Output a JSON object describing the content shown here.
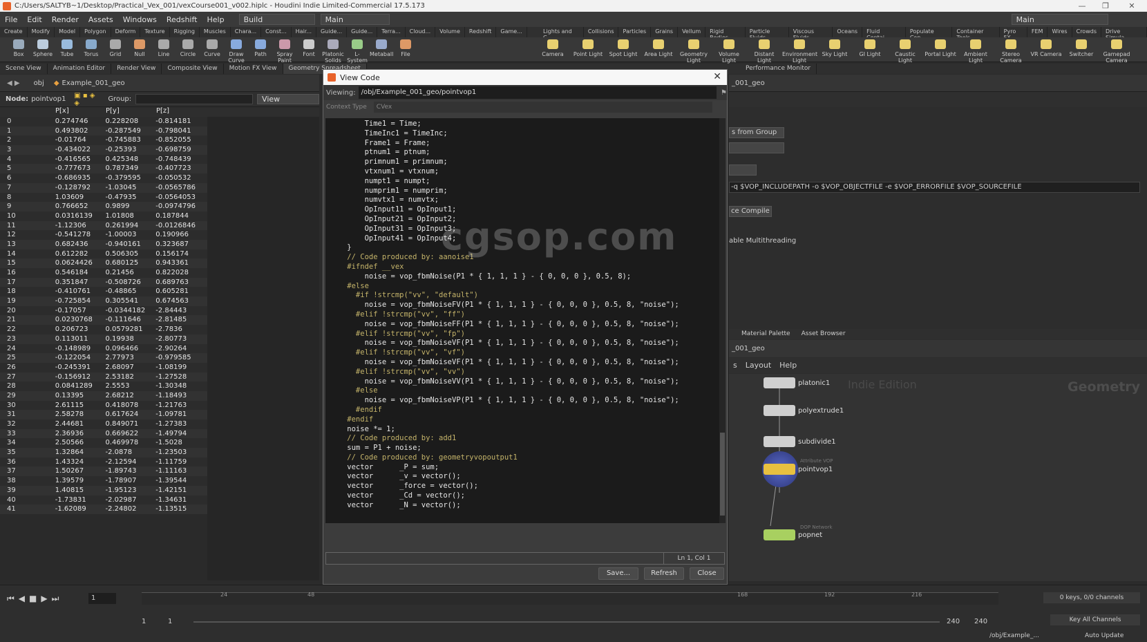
{
  "window": {
    "title": "C:/Users/SALTYB~1/Desktop/Practical_Vex_001/vexCourse001_v002.hiplc - Houdini Indie Limited-Commercial 17.5.173"
  },
  "menu": {
    "items": [
      "File",
      "Edit",
      "Render",
      "Assets",
      "Windows",
      "Redshift",
      "Help"
    ],
    "desktop": "Build",
    "main": "Main",
    "main_right": "Main"
  },
  "shelf_tabs_left": [
    "Create",
    "Modify",
    "Model",
    "Polygon",
    "Deform",
    "Texture",
    "Rigging",
    "Muscles",
    "Chara...",
    "Const...",
    "Hair...",
    "Guide...",
    "Guide...",
    "Terra...",
    "Cloud...",
    "Volume",
    "Redshift",
    "Game..."
  ],
  "shelf_tabs_right": [
    "Lights and C...",
    "Collisions",
    "Particles",
    "Grains",
    "Vellum",
    "Rigid Bodies",
    "Particle Fluids",
    "Viscous Fluids",
    "Oceans",
    "Fluid Contai...",
    "Populate Con...",
    "Container Tools",
    "Pyro FX",
    "FEM",
    "Wires",
    "Crowds",
    "Drive Simula..."
  ],
  "tools_left": [
    "Box",
    "Sphere",
    "Tube",
    "Torus",
    "Grid",
    "Null",
    "Line",
    "Circle",
    "Curve",
    "Draw Curve",
    "Path",
    "Spray Paint",
    "Font",
    "Platonic Solids",
    "L-System",
    "Metaball",
    "File"
  ],
  "tools_right": [
    "Camera",
    "Point Light",
    "Spot Light",
    "Area Light",
    "Geometry Light",
    "Volume Light",
    "Distant Light",
    "Environment Light",
    "Sky Light",
    "GI Light",
    "Caustic Light",
    "Portal Light",
    "Ambient Light",
    "Stereo Camera",
    "VR Camera",
    "Switcher",
    "Gamepad Camera"
  ],
  "pane_tabs": [
    "Scene View",
    "Animation Editor",
    "Render View",
    "Composite View",
    "Motion FX View",
    "Geometry Spreadsheet"
  ],
  "pane_tabs_right": [
    "Performance Monitor"
  ],
  "path": {
    "obj": "obj",
    "geo": "Example_001_geo"
  },
  "node_bar": {
    "label": "Node:",
    "node": "pointvop1",
    "group_label": "Group:",
    "view": "View"
  },
  "sheet": {
    "headers": [
      "",
      "P[x]",
      "P[y]",
      "P[z]"
    ],
    "rows": [
      [
        "0",
        "0.274746",
        "0.228208",
        "-0.814181"
      ],
      [
        "1",
        "0.493802",
        "-0.287549",
        "-0.798041"
      ],
      [
        "2",
        "-0.01764",
        "-0.745883",
        "-0.852055"
      ],
      [
        "3",
        "-0.434022",
        "-0.25393",
        "-0.698759"
      ],
      [
        "4",
        "-0.416565",
        "0.425348",
        "-0.748439"
      ],
      [
        "5",
        "-0.777673",
        "0.787349",
        "-0.407723"
      ],
      [
        "6",
        "-0.686935",
        "-0.379595",
        "-0.050532"
      ],
      [
        "7",
        "-0.128792",
        "-1.03045",
        "-0.0565786"
      ],
      [
        "8",
        "1.03609",
        "-0.47935",
        "-0.0564053"
      ],
      [
        "9",
        "0.766652",
        "0.9899",
        "-0.0974796"
      ],
      [
        "10",
        "0.0316139",
        "1.01808",
        "0.187844"
      ],
      [
        "11",
        "-1.12306",
        "0.261994",
        "-0.0126846"
      ],
      [
        "12",
        "-0.541278",
        "-1.00003",
        "0.190966"
      ],
      [
        "13",
        "0.682436",
        "-0.940161",
        "0.323687"
      ],
      [
        "14",
        "0.612282",
        "0.506305",
        "0.156174"
      ],
      [
        "15",
        "0.0624426",
        "0.680125",
        "0.943361"
      ],
      [
        "16",
        "0.546184",
        "0.21456",
        "0.822028"
      ],
      [
        "17",
        "0.351847",
        "-0.508726",
        "0.689763"
      ],
      [
        "18",
        "-0.410761",
        "-0.48865",
        "0.605281"
      ],
      [
        "19",
        "-0.725854",
        "0.305541",
        "0.674563"
      ],
      [
        "20",
        "-0.17057",
        "-0.0344182",
        "-2.84443"
      ],
      [
        "21",
        "0.0230768",
        "-0.111646",
        "-2.81485"
      ],
      [
        "22",
        "0.206723",
        "0.0579281",
        "-2.7836"
      ],
      [
        "23",
        "0.113011",
        "0.19938",
        "-2.80773"
      ],
      [
        "24",
        "-0.148989",
        "0.096466",
        "-2.90264"
      ],
      [
        "25",
        "-0.122054",
        "2.77973",
        "-0.979585"
      ],
      [
        "26",
        "-0.245391",
        "2.68097",
        "-1.08199"
      ],
      [
        "27",
        "-0.156912",
        "2.53182",
        "-1.27528"
      ],
      [
        "28",
        "0.0841289",
        "2.5553",
        "-1.30348"
      ],
      [
        "29",
        "0.13395",
        "2.68212",
        "-1.18493"
      ],
      [
        "30",
        "2.61115",
        "0.418078",
        "-1.21763"
      ],
      [
        "31",
        "2.58278",
        "0.617624",
        "-1.09781"
      ],
      [
        "32",
        "2.44681",
        "0.849071",
        "-1.27383"
      ],
      [
        "33",
        "2.36936",
        "0.669622",
        "-1.49794"
      ],
      [
        "34",
        "2.50566",
        "0.469978",
        "-1.5028"
      ],
      [
        "35",
        "1.32864",
        "-2.0878",
        "-1.23503"
      ],
      [
        "36",
        "1.43324",
        "-2.12594",
        "-1.11759"
      ],
      [
        "37",
        "1.50267",
        "-1.89743",
        "-1.11163"
      ],
      [
        "38",
        "1.39579",
        "-1.78907",
        "-1.39544"
      ],
      [
        "39",
        "1.40815",
        "-1.95123",
        "-1.42151"
      ],
      [
        "40",
        "-1.73831",
        "-2.02987",
        "-1.34631"
      ],
      [
        "41",
        "-1.62089",
        "-2.24802",
        "-1.13515"
      ]
    ]
  },
  "dialog": {
    "title": "View Code",
    "viewing_label": "Viewing:",
    "viewing_path": "/obj/Example_001_geo/pointvop1",
    "context_label": "Context Type",
    "context_value": "CVex",
    "status": "Ln 1, Col 1",
    "buttons": {
      "save": "Save...",
      "refresh": "Refresh",
      "close": "Close"
    },
    "code_lines": [
      "        Time1 = Time;",
      "        TimeInc1 = TimeInc;",
      "        Frame1 = Frame;",
      "        ptnum1 = ptnum;",
      "        primnum1 = primnum;",
      "        vtxnum1 = vtxnum;",
      "        numpt1 = numpt;",
      "        numprim1 = numprim;",
      "        numvtx1 = numvtx;",
      "        OpInput11 = OpInput1;",
      "        OpInput21 = OpInput2;",
      "        OpInput31 = OpInput3;",
      "        OpInput41 = OpInput4;",
      "    }",
      "",
      "    // Code produced by: aanoise1",
      "    #ifndef __vex",
      "        noise = vop_fbmNoise(P1 * { 1, 1, 1 } - { 0, 0, 0 }, 0.5, 8);",
      "    #else",
      "      #if !strcmp(\"vv\", \"default\")",
      "        noise = vop_fbmNoiseFV(P1 * { 1, 1, 1 } - { 0, 0, 0 }, 0.5, 8, \"noise\");",
      "      #elif !strcmp(\"vv\", \"ff\")",
      "        noise = vop_fbmNoiseFF(P1 * { 1, 1, 1 } - { 0, 0, 0 }, 0.5, 8, \"noise\");",
      "      #elif !strcmp(\"vv\", \"fp\")",
      "        noise = vop_fbmNoiseVF(P1 * { 1, 1, 1 } - { 0, 0, 0 }, 0.5, 8, \"noise\");",
      "      #elif !strcmp(\"vv\", \"vf\")",
      "        noise = vop_fbmNoiseVF(P1 * { 1, 1, 1 } - { 0, 0, 0 }, 0.5, 8, \"noise\");",
      "      #elif !strcmp(\"vv\", \"vv\")",
      "        noise = vop_fbmNoiseVV(P1 * { 1, 1, 1 } - { 0, 0, 0 }, 0.5, 8, \"noise\");",
      "      #else",
      "        noise = vop_fbmNoiseVP(P1 * { 1, 1, 1 } - { 0, 0, 0 }, 0.5, 8, \"noise\");",
      "      #endif",
      "    #endif",
      "    noise *= 1;",
      "",
      "    // Code produced by: add1",
      "    sum = P1 + noise;",
      "",
      "    // Code produced by: geometryvopoutput1",
      "    vector      _P = sum;",
      "    vector      _v = vector();",
      "    vector      _force = vector();",
      "    vector      _Cd = vector();",
      "    vector      _N = vector();"
    ]
  },
  "watermark": "cgsop.com",
  "right_pane": {
    "geo_path": "_001_geo",
    "from_group": "s from Group",
    "compile_cmd": "-q $VOP_INCLUDEPATH -o $VOP_OBJECTFILE -e $VOP_ERRORFILE $VOP_SOURCEFILE",
    "force_compile": "ce Compile",
    "multithreading": "able Multithreading",
    "tabs": [
      "Material Palette",
      "Asset Browser"
    ],
    "net_path": "_001_geo",
    "net_menu": [
      "s",
      "Layout",
      "Help"
    ],
    "indie": "Indie Edition",
    "geometry": "Geometry",
    "nodes": [
      "platonic1",
      "polyextrude1",
      "subdivide1",
      "pointvop1",
      "popnet"
    ],
    "node_subtitles": {
      "pointvop1": "Attribute VOP",
      "popnet": "DOP Network"
    }
  },
  "timeline": {
    "frame": "1",
    "start": "1",
    "start2": "1",
    "end": "240",
    "end2": "240",
    "marks": [
      "24",
      "48",
      "168",
      "192",
      "216"
    ],
    "keys": "0 keys, 0/0 channels",
    "key_all": "Key All Channels",
    "obj_path": "/obj/Example_...",
    "auto_update": "Auto Update"
  }
}
